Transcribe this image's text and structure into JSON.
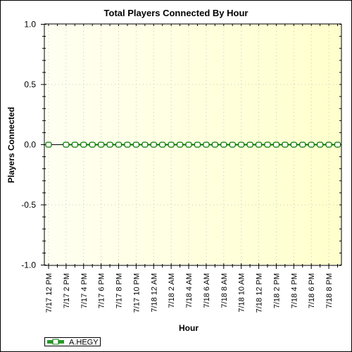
{
  "chart_data": {
    "type": "line",
    "title": "Total Players Connected By Hour",
    "xlabel": "Hour",
    "ylabel": "Players Connected",
    "ylim": [
      -1.0,
      1.0
    ],
    "y_major_ticks": [
      1.0,
      0.5,
      0.0,
      -0.5,
      -1.0
    ],
    "y_tick_labels": [
      "1.0",
      "0.5",
      "0.0",
      "-0.5",
      "-1.0"
    ],
    "y_minor_step": 0.1,
    "x_range_hours": [
      0,
      33
    ],
    "x_tick_labels": [
      {
        "hour": 0,
        "label": "7/17 12 PM"
      },
      {
        "hour": 2,
        "label": "7/17 2 PM"
      },
      {
        "hour": 4,
        "label": "7/17 4 PM"
      },
      {
        "hour": 6,
        "label": "7/17 6 PM"
      },
      {
        "hour": 8,
        "label": "7/17 8 PM"
      },
      {
        "hour": 10,
        "label": "7/17 10 PM"
      },
      {
        "hour": 12,
        "label": "7/18 12 AM"
      },
      {
        "hour": 14,
        "label": "7/18 2 AM"
      },
      {
        "hour": 16,
        "label": "7/18 4 AM"
      },
      {
        "hour": 18,
        "label": "7/18 6 AM"
      },
      {
        "hour": 20,
        "label": "7/18 8 AM"
      },
      {
        "hour": 22,
        "label": "7/18 10 AM"
      },
      {
        "hour": 24,
        "label": "7/18 12 PM"
      },
      {
        "hour": 26,
        "label": "7/18 2 PM"
      },
      {
        "hour": 28,
        "label": "7/18 4 PM"
      },
      {
        "hour": 30,
        "label": "7/18 6 PM"
      },
      {
        "hour": 32,
        "label": "7/18 8 PM"
      }
    ],
    "grid": true,
    "legend_position": "bottom-left",
    "series": [
      {
        "name": "A.HEGY",
        "color": "#007700",
        "x_hours": [
          0,
          null,
          2,
          3,
          4,
          5,
          6,
          7,
          8,
          9,
          10,
          11,
          12,
          13,
          14,
          15,
          16,
          17,
          18,
          19,
          20,
          21,
          22,
          23,
          24,
          25,
          26,
          27,
          28,
          29,
          30,
          31,
          32,
          33
        ],
        "values": [
          0,
          null,
          0,
          0,
          0,
          0,
          0,
          0,
          0,
          0,
          0,
          0,
          0,
          0,
          0,
          0,
          0,
          0,
          0,
          0,
          0,
          0,
          0,
          0,
          0,
          0,
          0,
          0,
          0,
          0,
          0,
          0,
          0,
          0
        ]
      }
    ]
  }
}
